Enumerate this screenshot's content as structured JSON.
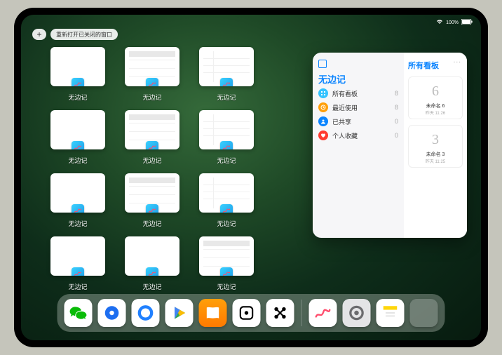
{
  "status": {
    "time": "",
    "battery": "100%",
    "wifi": "wifi"
  },
  "topbar": {
    "plus": "+",
    "reopen_label": "重新打开已关闭的窗口"
  },
  "app_name": "无边记",
  "expose_windows": [
    {
      "label": "无边记",
      "variant": "a"
    },
    {
      "label": "无边记",
      "variant": "b"
    },
    {
      "label": "无边记",
      "variant": "c"
    },
    {
      "label": null,
      "variant": null
    },
    {
      "label": "无边记",
      "variant": "a"
    },
    {
      "label": "无边记",
      "variant": "b"
    },
    {
      "label": "无边记",
      "variant": "c"
    },
    {
      "label": null,
      "variant": null
    },
    {
      "label": "无边记",
      "variant": "a"
    },
    {
      "label": "无边记",
      "variant": "b"
    },
    {
      "label": "无边记",
      "variant": "c"
    },
    {
      "label": null,
      "variant": null
    },
    {
      "label": "无边记",
      "variant": "a"
    },
    {
      "label": "无边记",
      "variant": "a"
    },
    {
      "label": "无边记",
      "variant": "b"
    }
  ],
  "slideover": {
    "title": "无边记",
    "right_title": "所有看板",
    "more": "...",
    "items": [
      {
        "icon": "grid",
        "color": "#34c3ff",
        "label": "所有看板",
        "count": "8"
      },
      {
        "icon": "clock",
        "color": "#ff9f0a",
        "label": "最近使用",
        "count": "8"
      },
      {
        "icon": "people",
        "color": "#0a84ff",
        "label": "已共享",
        "count": "0"
      },
      {
        "icon": "heart",
        "color": "#ff3b30",
        "label": "个人收藏",
        "count": "0"
      }
    ],
    "boards": [
      {
        "sketch": "6",
        "name": "未命名 6",
        "time": "昨天 11:26"
      },
      {
        "sketch": "3",
        "name": "未命名 3",
        "time": "昨天 11:25"
      }
    ]
  },
  "dock": [
    {
      "name": "wechat",
      "bg": "#fff",
      "fg": "#09bb07",
      "glyph": "wechat"
    },
    {
      "name": "qqbrowser",
      "bg": "#fff",
      "fg": "#1d6ef0",
      "glyph": "circle"
    },
    {
      "name": "quark",
      "bg": "#fff",
      "fg": "#2080ff",
      "glyph": "ring"
    },
    {
      "name": "play",
      "bg": "#fff",
      "fg": "#34a853",
      "glyph": "play"
    },
    {
      "name": "books",
      "bg": "linear-gradient(#ff9f0a,#ff7a00)",
      "fg": "#fff",
      "glyph": "book"
    },
    {
      "name": "dice",
      "bg": "#fff",
      "fg": "#000",
      "glyph": "dice"
    },
    {
      "name": "dots",
      "bg": "#fff",
      "fg": "#000",
      "glyph": "dots"
    },
    {
      "name": "sep"
    },
    {
      "name": "freeform",
      "bg": "#fff",
      "fg": "#3ad1ff",
      "glyph": "scribble"
    },
    {
      "name": "settings",
      "bg": "#e4e4e6",
      "fg": "#6b6b6e",
      "glyph": "gear"
    },
    {
      "name": "notes",
      "bg": "#fff",
      "fg": "#ffd60a",
      "glyph": "notes"
    },
    {
      "name": "apps-group",
      "glyph": "group"
    }
  ]
}
